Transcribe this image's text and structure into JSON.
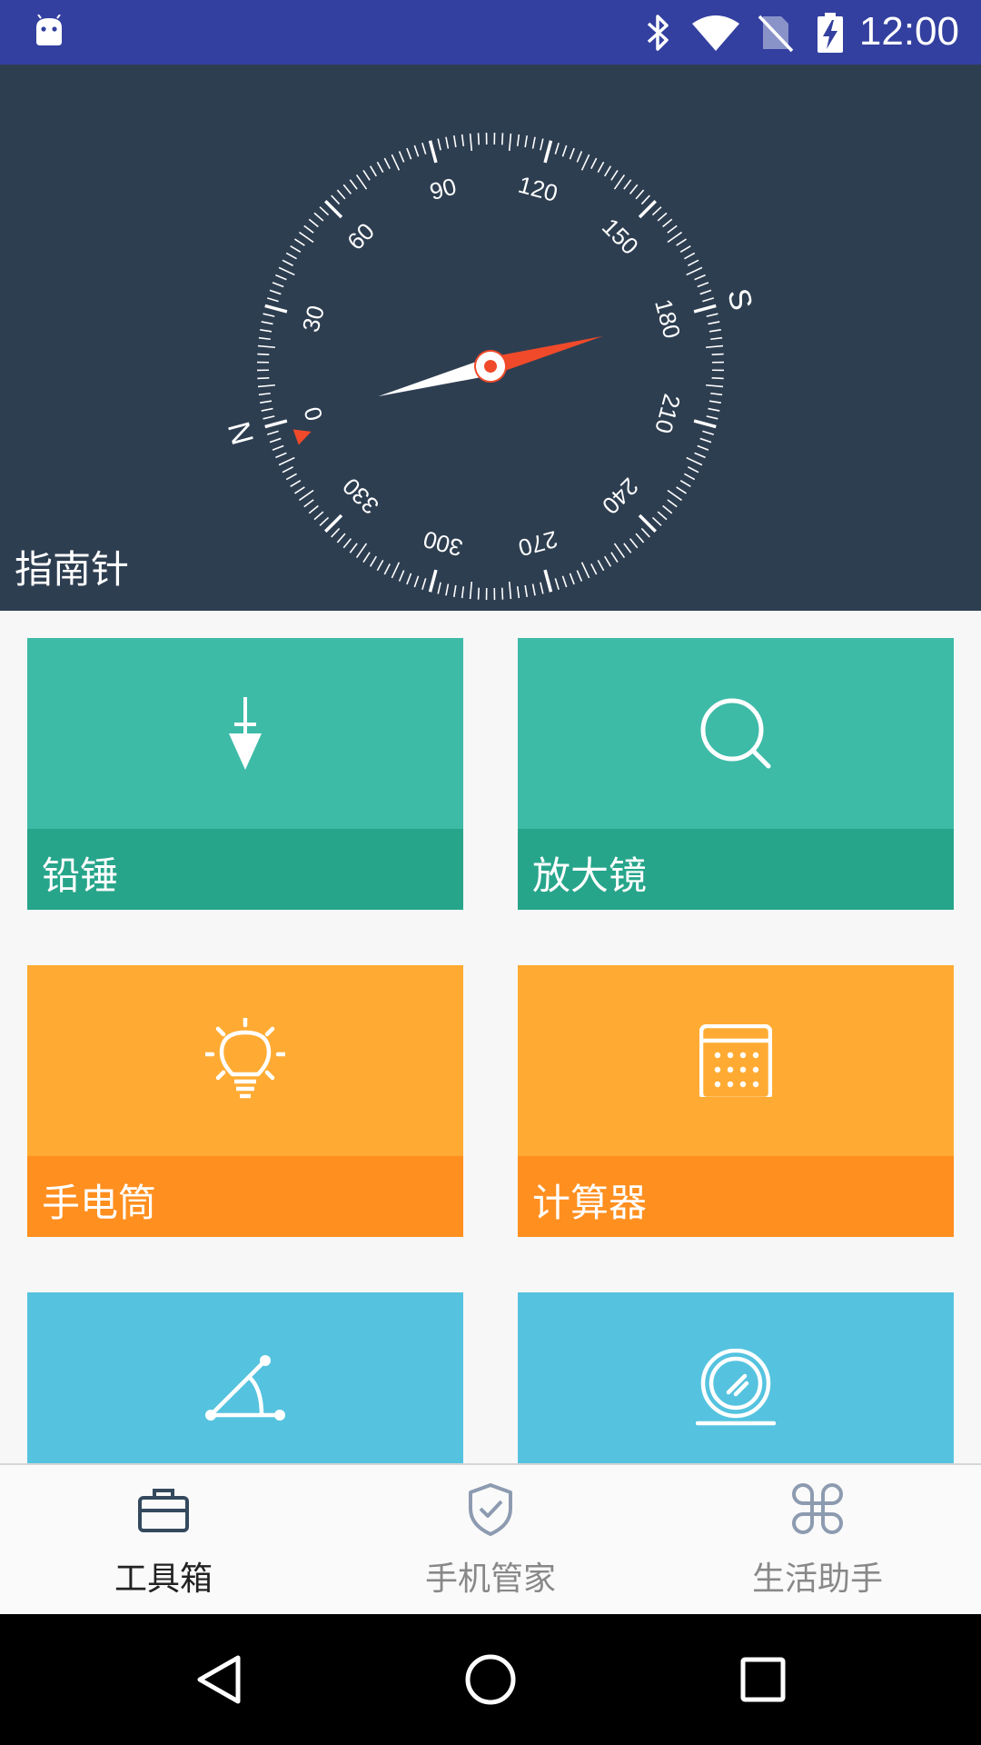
{
  "status_bar": {
    "time": "12:00",
    "icons": [
      "android-debug-icon",
      "bluetooth-icon",
      "wifi-icon",
      "no-sim-icon",
      "battery-charging-icon"
    ]
  },
  "compass": {
    "title": "指南针",
    "cardinal_labels": [
      "N",
      "S"
    ],
    "degree_labels": [
      "0",
      "30",
      "60",
      "90",
      "120",
      "150",
      "180",
      "210",
      "240",
      "270",
      "300",
      "330"
    ],
    "colors": {
      "background": "#2e3e51",
      "needle_north": "#f04a2a",
      "needle_south": "#ffffff"
    }
  },
  "tools": [
    {
      "label": "铅锤",
      "icon": "plumb-bob-icon",
      "color": "teal"
    },
    {
      "label": "放大镜",
      "icon": "magnifier-icon",
      "color": "teal"
    },
    {
      "label": "手电筒",
      "icon": "lightbulb-icon",
      "color": "orange"
    },
    {
      "label": "计算器",
      "icon": "calculator-icon",
      "color": "orange"
    },
    {
      "label": "",
      "icon": "protractor-icon",
      "color": "blue"
    },
    {
      "label": "",
      "icon": "mirror-icon",
      "color": "blue"
    }
  ],
  "bottom_nav": {
    "items": [
      {
        "label": "工具箱",
        "icon": "toolbox-icon",
        "active": true
      },
      {
        "label": "手机管家",
        "icon": "shield-check-icon",
        "active": false
      },
      {
        "label": "生活助手",
        "icon": "command-icon",
        "active": false
      }
    ]
  },
  "system_nav": [
    "back-icon",
    "home-icon",
    "recents-icon"
  ]
}
